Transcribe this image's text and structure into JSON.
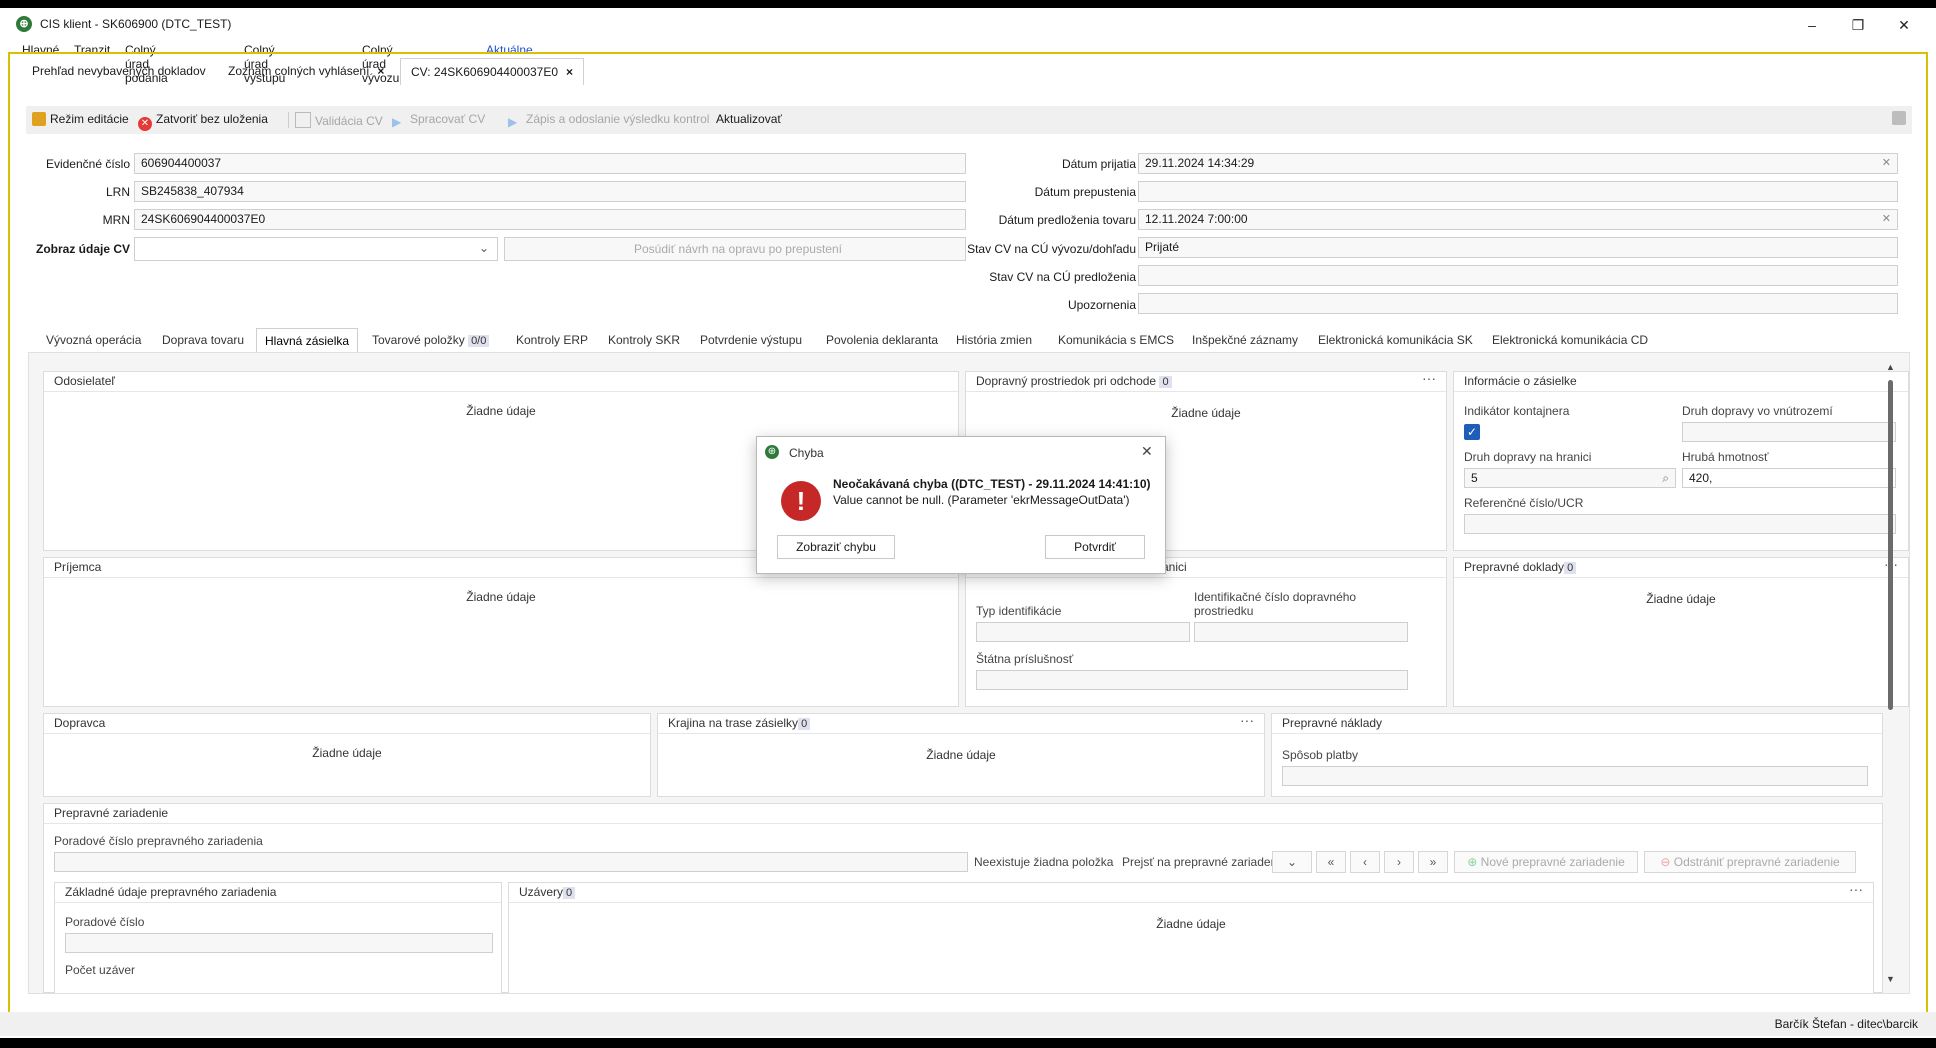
{
  "window": {
    "title": "CIS klient - SK606900 (DTC_TEST)",
    "minimize": "–",
    "maximize": "❐",
    "close": "✕"
  },
  "menu": [
    "Hlavné",
    "Tranzit",
    "Colný úrad podania",
    "Colný úrad výstupu",
    "Colný úrad vývozu",
    "Aktuálne CV"
  ],
  "doc_tabs": [
    "Prehľad nevybavených dokladov",
    "Zoznam colných vyhlásení",
    "CV: 24SK606904400037E0"
  ],
  "toolbar": {
    "edit_mode": "Režim editácie",
    "close_no_save": "Zatvoriť bez uloženia",
    "validate": "Validácia CV",
    "process": "Spracovať CV",
    "write_send": "Zápis a odoslanie výsledku kontrol",
    "refresh": "Aktualizovať"
  },
  "form": {
    "evid_label": "Evidenčné číslo",
    "evid_value": "606904400037",
    "lrn_label": "LRN",
    "lrn_value": "SB245838_407934",
    "mrn_label": "MRN",
    "mrn_value": "24SK606904400037E0",
    "show_label": "Zobraz údaje CV",
    "assess_button": "Posúdiť návrh na opravu po prepustení",
    "received_label": "Dátum prijatia",
    "received_value": "29.11.2024 14:34:29",
    "release_label": "Dátum prepustenia",
    "release_value": "",
    "presentation_label": "Dátum predloženia tovaru",
    "presentation_value": "12.11.2024 7:00:00",
    "status_export_label": "Stav CV na CÚ vývozu/dohľadu",
    "status_export_value": "Prijaté",
    "status_pres_label": "Stav CV na CÚ predloženia",
    "status_pres_value": "",
    "warnings_label": "Upozornenia",
    "warnings_value": ""
  },
  "sub_tabs": [
    "Vývozná operácia",
    "Doprava tovaru",
    "Hlavná zásielka",
    "Tovarové položky",
    "Kontroly ERP",
    "Kontroly SKR",
    "Potvrdenie výstupu",
    "Povolenia deklaranta",
    "História zmien",
    "Komunikácia s EMCS",
    "Inšpekčné záznamy",
    "Elektronická komunikácia SK",
    "Elektronická komunikácia CD"
  ],
  "sub_tab_count": "0/0",
  "empty_text": "Žiadne údaje",
  "panels": {
    "sender": "Odosielateľ",
    "transport_exit": "Dopravný prostriedok pri odchode",
    "transport_exit_count": "0",
    "shipment_info": "Informácie o zásielke",
    "container_label": "Indikátor kontajnera",
    "inland_label": "Druh dopravy vo vnútrozemí",
    "border_mode_label": "Druh dopravy na hranici",
    "border_mode_value": "5",
    "gross_label": "Hrubá hmotnosť",
    "gross_value": "420,",
    "ucr_label": "Referenčné číslo/UCR",
    "receiver": "Príjemca",
    "border_partial": "anici",
    "type_id_label": "Typ identifikácie",
    "transport_id_label1": "Identifikačné číslo dopravného",
    "transport_id_label2": "prostriedku",
    "nationality_label": "Štátna príslušnosť",
    "transport_docs": "Prepravné doklady",
    "transport_docs_count": "0",
    "carrier": "Dopravca",
    "route_countries": "Krajina na trase zásielky",
    "route_countries_count": "0",
    "transport_costs": "Prepravné náklady",
    "payment_label": "Spôsob platby",
    "equipment": "Prepravné zariadenie",
    "equip_seq_label": "Poradové číslo prepravného zariadenia",
    "no_item_text": "Neexistuje žiadna položka",
    "goto_label": "Prejsť na prepravné zariadenie",
    "new_equip": "Nové prepravné zariadenie",
    "remove_equip": "Odstrániť prepravné zariadenie",
    "equip_basic": "Základné údaje prepravného zariadenia",
    "seq_label": "Poradové číslo",
    "seals_count_label": "Počet uzáver",
    "seals": "Uzávery",
    "seals_count": "0"
  },
  "dialog": {
    "title": "Chyba",
    "heading": "Neočakávaná chyba ((DTC_TEST) - 29.11.2024 14:41:10)",
    "message": "Value cannot be null. (Parameter 'ekrMessageOutData')",
    "show_error": "Zobraziť chybu",
    "confirm": "Potvrdiť"
  },
  "status": {
    "user": "Barčík Štefan - ditec\\barcik"
  },
  "colors": {
    "accent": "#1e5eb8",
    "error": "#c62828",
    "frame": "#d6c200"
  }
}
